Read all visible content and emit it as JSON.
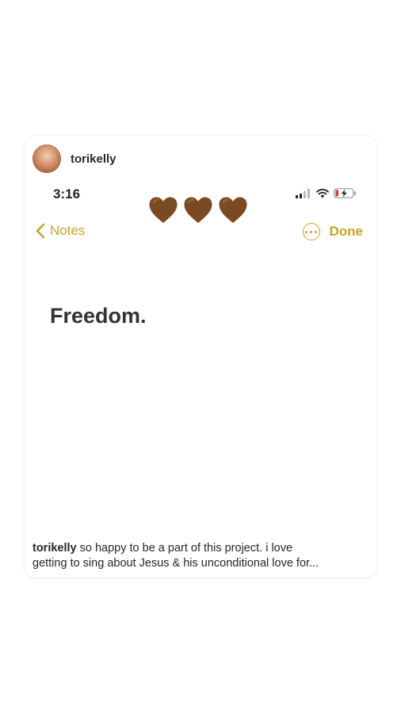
{
  "post": {
    "username": "torikelly",
    "caption_user": "torikelly",
    "caption_line1": "so happy to be a part of this project. i love",
    "caption_line2": "getting to sing about Jesus & his unconditional love for..."
  },
  "phone": {
    "status_time": "3:16",
    "icons": [
      "signal-icon",
      "wifi-icon",
      "battery-charging-icon"
    ],
    "nav_back_label": "Notes",
    "done_label": "Done",
    "note_text": "Freedom.",
    "accent_color": "#c9a227"
  },
  "stickers": {
    "hearts": [
      "brown-heart-emoji",
      "brown-heart-emoji",
      "brown-heart-emoji"
    ],
    "heart_color": "#7a4a22"
  }
}
